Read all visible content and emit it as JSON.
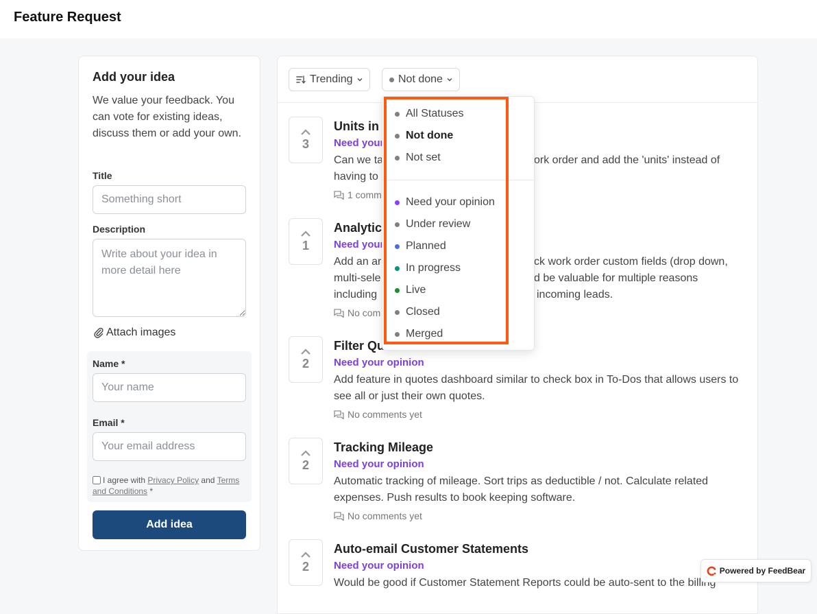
{
  "header": {
    "title": "Feature Request"
  },
  "form": {
    "title": "Add your idea",
    "description": "We value your feedback. You can vote for existing ideas, discuss them or add your own.",
    "title_label": "Title",
    "title_placeholder": "Something short",
    "description_label": "Description",
    "description_placeholder": "Write about your idea in more detail here",
    "attach_label": "Attach images",
    "name_label": "Name *",
    "name_placeholder": "Your name",
    "email_label": "Email *",
    "email_placeholder": "Your email address",
    "agree_prefix": "I agree with",
    "privacy_link": "Privacy Policy",
    "agree_and": "and",
    "terms_link": "Terms and Conditions",
    "agree_suffix": "*",
    "submit_label": "Add idea"
  },
  "filters": {
    "sort_label": "Trending",
    "status_label": "Not done"
  },
  "status_menu": {
    "items": [
      {
        "label": "All Statuses",
        "color": "#808080",
        "selected": false
      },
      {
        "label": "Not done",
        "color": "#808080",
        "selected": true
      },
      {
        "label": "Not set",
        "color": "#808080",
        "selected": false
      },
      {
        "label": "Need your opinion",
        "color": "#8a3ff0",
        "selected": false
      },
      {
        "label": "Under review",
        "color": "#808080",
        "selected": false
      },
      {
        "label": "Planned",
        "color": "#4f6fd6",
        "selected": false
      },
      {
        "label": "In progress",
        "color": "#0f8f7a",
        "selected": false
      },
      {
        "label": "Live",
        "color": "#1f8a2f",
        "selected": false
      },
      {
        "label": "Closed",
        "color": "#808080",
        "selected": false
      },
      {
        "label": "Merged",
        "color": "#808080",
        "selected": false
      }
    ]
  },
  "ideas": [
    {
      "votes": "3",
      "title": "Units in",
      "status": "Need your",
      "desc1": "Can we ta",
      "desc1_right": "ork order and add the 'units' instead of",
      "desc2": "having to",
      "comments": "1 comm"
    },
    {
      "votes": "1",
      "title": "Analytic",
      "status": "Need your",
      "desc1": "Add an ar",
      "desc1_right": "ck work order custom fields (drop down,",
      "desc2": "multi-sele",
      "desc2_right": "d be valuable for multiple reasons",
      "desc3": "including",
      "desc3_right": "incoming leads.",
      "comments": "No com"
    },
    {
      "votes": "2",
      "title": "Filter Qu",
      "status": "Need your opinion",
      "desc": "Add feature in quotes dashboard similar to check box in To-Dos that allows users to see all or just their own quotes.",
      "comments": "No comments yet"
    },
    {
      "votes": "2",
      "title": "Tracking Mileage",
      "status": "Need your opinion",
      "desc": "Automatic tracking of mileage. Sort trips as deductible / not. Calculate related expenses. Push results to book keeping software.",
      "comments": "No comments yet"
    },
    {
      "votes": "2",
      "title": "Auto-email Customer Statements",
      "status": "Need your opinion",
      "desc": "Would be good if Customer Statement Reports could be auto-sent to the billing",
      "comments": ""
    }
  ],
  "powered": {
    "label": "Powered by FeedBear"
  },
  "colors": {
    "accent": "#1d4a7d",
    "status_purple": "#7b3fe4",
    "highlight": "#ff5a0f"
  }
}
